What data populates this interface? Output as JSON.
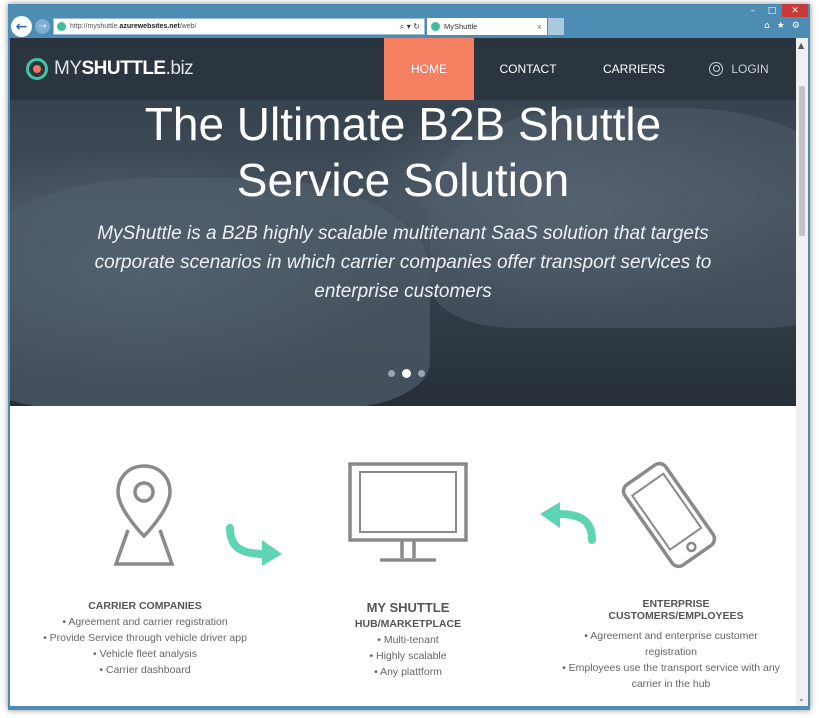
{
  "browser": {
    "address_url_prefix": "http://myshuttle.",
    "address_url_host": "azurewebsites.net",
    "address_url_path": "/web/",
    "address_tools": "⌕ ▾ ↻",
    "tab_title": "MyShuttle",
    "tab_close": "×",
    "window_min": "–",
    "window_max": "□",
    "window_close": "✕",
    "home_icon": "⌂",
    "favorites_icon": "★",
    "settings_icon": "⚙",
    "back_icon": "←",
    "forward_icon": "→"
  },
  "site": {
    "logo": {
      "my": "MY",
      "shuttle": "SHUTTLE",
      "biz": ".biz"
    },
    "nav": {
      "home": "HOME",
      "contact": "CONTACT",
      "carriers": "CARRIERS",
      "login": "LOGIN"
    },
    "nav_active": "HOME",
    "accent_color": "#f47f61",
    "brand_teal": "#3cc7a4"
  },
  "hero": {
    "title_line1": "The Ultimate B2B Shuttle",
    "title_line2": "Service Solution",
    "subtitle_line1": "MyShuttle is a B2B highly scalable multitenant SaaS solution that targets",
    "subtitle_line2": "corporate scenarios in which carrier companies offer transport services to",
    "subtitle_line3": "enterprise customers",
    "carousel_slides": 3,
    "carousel_active": 2
  },
  "features": {
    "carrier": {
      "title": "CARRIER COMPANIES",
      "items": [
        "• Agreement and carrier registration",
        "• Provide Service through vehicle driver app",
        "• Vehicle fleet analysis",
        "• Carrier dashboard"
      ]
    },
    "hub": {
      "title": "MY SHUTTLE",
      "subtitle": "HUB/MARKETPLACE",
      "items": [
        "• Multi-tenant",
        "• Highly scalable",
        "• Any plattform"
      ]
    },
    "enterprise": {
      "title_line1": "ENTERPRISE",
      "title_line2": "CUSTOMERS/EMPLOYEES",
      "items": [
        "• Agreement and enterprise customer",
        "registration",
        "• Employees use the transport service with any",
        "carrier in the hub"
      ]
    }
  },
  "scrollbar": {
    "up": "▲",
    "down": "⌄"
  }
}
